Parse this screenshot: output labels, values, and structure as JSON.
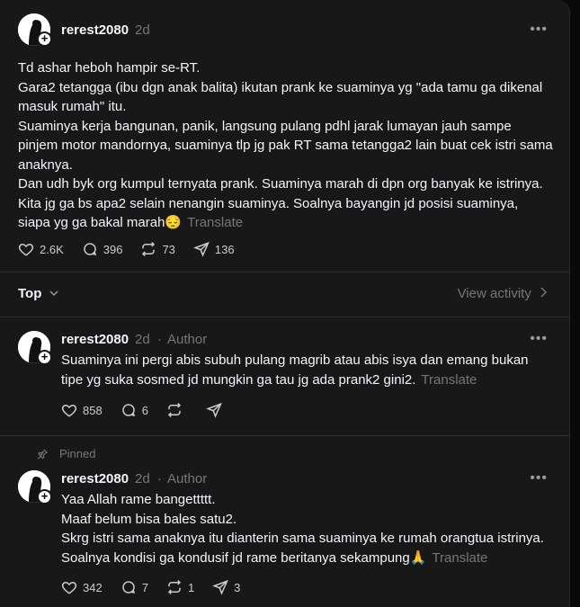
{
  "post": {
    "username": "rerest2080",
    "time": "2d",
    "lines": "Td ashar heboh hampir se-RT.\nGara2 tetangga (ibu dgn anak balita) ikutan prank ke suaminya yg \"ada tamu ga dikenal masuk rumah\" itu.\nSuaminya kerja bangunan, panik, langsung pulang pdhl jarak lumayan jauh sampe pinjem motor mandornya, suaminya tlp jg pak RT sama tetangga2 lain buat cek istri sama anaknya.\nDan udh byk org kumpul ternyata prank. Suaminya marah di dpn org banyak ke istrinya.\nKita jg ga bs apa2 selain nenangin suaminya. Soalnya bayangin jd posisi suaminya, siapa yg ga bakal marah😔",
    "translate": "Translate",
    "likes": "2.6K",
    "replies": "396",
    "reposts": "73",
    "shares": "136"
  },
  "sort": {
    "label": "Top",
    "view_activity": "View activity"
  },
  "reply1": {
    "username": "rerest2080",
    "time": "2d",
    "author_tag": "Author",
    "text": "Suaminya ini pergi abis subuh pulang magrib atau abis isya dan emang bukan tipe yg suka sosmed jd mungkin ga tau jg ada prank2 gini2.",
    "translate": "Translate",
    "likes": "858",
    "replies": "6"
  },
  "reply2": {
    "pinned_label": "Pinned",
    "username": "rerest2080",
    "time": "2d",
    "author_tag": "Author",
    "text": "Yaa Allah rame banget​tttt.\nMaaf belum bisa bales satu2.\nSkrg istri sama anaknya itu dianterin sama suaminya ke rumah orangtua istrinya.\nSoalnya kondisi ga kondusif jd rame beritanya sekampung🙏",
    "translate": "Translate",
    "likes": "342",
    "replies": "7",
    "reposts": "1",
    "shares": "3"
  },
  "icons": {
    "more": "more-horizontal-icon",
    "like": "heart-icon",
    "reply": "comment-icon",
    "repost": "repost-icon",
    "share": "send-icon",
    "pin": "pin-icon"
  },
  "colors": {
    "background": "#181818",
    "text": "#f3f5f7",
    "muted": "#777777"
  }
}
